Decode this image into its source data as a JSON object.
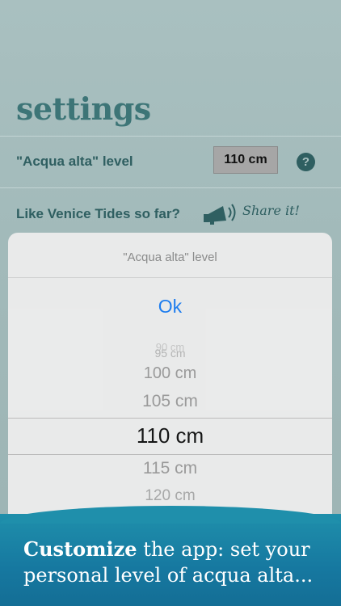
{
  "page": {
    "title": "settings"
  },
  "settings": {
    "level_label": "\"Acqua alta\" level",
    "level_value": "110 cm",
    "help_glyph": "?",
    "like_label": "Like Venice Tides so far?",
    "share_label": "Share it!"
  },
  "picker": {
    "title": "\"Acqua alta\" level",
    "ok_label": "Ok",
    "options": [
      "90 cm",
      "95 cm",
      "100 cm",
      "105 cm",
      "110 cm",
      "115 cm",
      "120 cm"
    ],
    "selected": "110 cm"
  },
  "banner": {
    "bold_word": "Customize",
    "rest_line1": " the app: set your",
    "line2": "personal level of acqua alta..."
  },
  "colors": {
    "accent_teal": "#2f5f61",
    "ios_blue": "#1a7cf0",
    "banner_blue": "#1678a0"
  },
  "icons": [
    "megaphone-icon",
    "help-icon"
  ]
}
